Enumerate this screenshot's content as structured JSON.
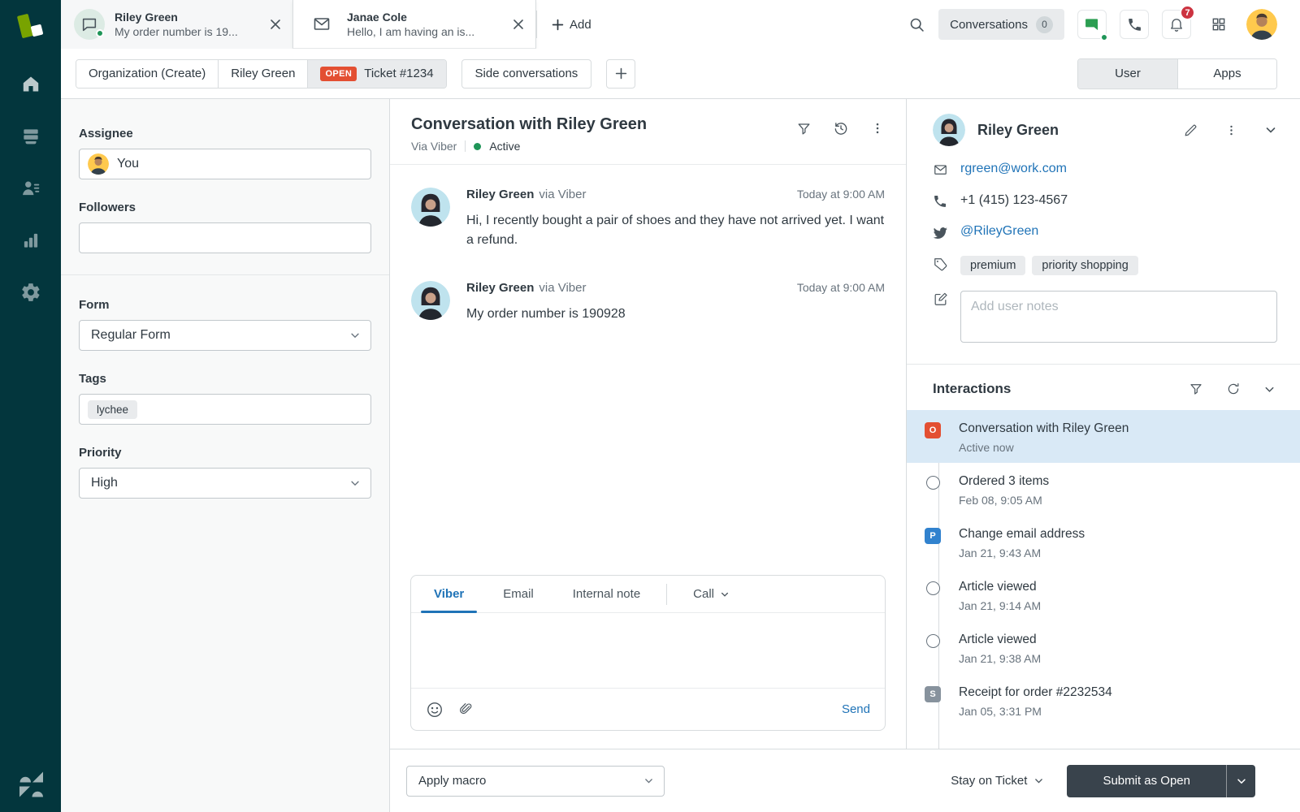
{
  "colors": {
    "kale": "#03363d",
    "accent_blue": "#1f73b7",
    "open_red": "#e34f32",
    "logo_green": "#78a300",
    "messaging_green": "#2b9e51",
    "selected_row_blue": "#d9e9f6"
  },
  "sidebar": {
    "icons": [
      "home",
      "views",
      "customers",
      "reports",
      "admin",
      "zendesk-logo"
    ]
  },
  "tabs": {
    "items": [
      {
        "title": "Riley Green",
        "subtitle": "My order number is 19...",
        "channel": "chat"
      },
      {
        "title": "Janae Cole",
        "subtitle": "Hello, I am having an is...",
        "channel": "email"
      }
    ],
    "add_label": "Add"
  },
  "topbar": {
    "conversations_label": "Conversations",
    "conversations_count": "0",
    "notifications_badge": "7"
  },
  "ticket_nav": {
    "segments": [
      {
        "label": "Organization (Create)"
      },
      {
        "label": "Riley Green"
      },
      {
        "label": "Ticket #1234",
        "status_badge": "OPEN"
      }
    ],
    "side_conversations_label": "Side conversations",
    "context_tabs": [
      {
        "label": "User"
      },
      {
        "label": "Apps"
      }
    ]
  },
  "ticket_fields": {
    "assignee_label": "Assignee",
    "assignee_value": "You",
    "followers_label": "Followers",
    "form_label": "Form",
    "form_value": "Regular Form",
    "tags_label": "Tags",
    "tags": [
      "lychee"
    ],
    "priority_label": "Priority",
    "priority_value": "High"
  },
  "conversation": {
    "title": "Conversation with Riley Green",
    "via": "Via Viber",
    "status": "Active",
    "messages": [
      {
        "author": "Riley Green",
        "via": "via Viber",
        "time": "Today at 9:00 AM",
        "text": "Hi, I recently bought a pair of shoes and they have not arrived yet. I want a refund."
      },
      {
        "author": "Riley Green",
        "via": "via Viber",
        "time": "Today at 9:00 AM",
        "text": "My order number is 190928"
      }
    ],
    "composer": {
      "tabs": [
        "Viber",
        "Email",
        "Internal note"
      ],
      "call_label": "Call",
      "send_label": "Send"
    }
  },
  "customer": {
    "name": "Riley Green",
    "email": "rgreen@work.com",
    "phone": "+1 (415) 123-4567",
    "twitter": "@RileyGreen",
    "tags": [
      "premium",
      "priority shopping"
    ],
    "notes_placeholder": "Add user notes"
  },
  "interactions": {
    "title": "Interactions",
    "items": [
      {
        "badge": "O",
        "title": "Conversation with Riley Green",
        "time": "Active now"
      },
      {
        "badge": "",
        "title": "Ordered 3 items",
        "time": "Feb 08, 9:05 AM"
      },
      {
        "badge": "P",
        "title": "Change email address",
        "time": "Jan 21, 9:43 AM"
      },
      {
        "badge": "",
        "title": "Article viewed",
        "time": "Jan 21, 9:14 AM"
      },
      {
        "badge": "",
        "title": "Article viewed",
        "time": "Jan 21, 9:38 AM"
      },
      {
        "badge": "S",
        "title": "Receipt for order #2232534",
        "time": "Jan 05, 3:31 PM"
      }
    ]
  },
  "footer": {
    "apply_macro_label": "Apply macro",
    "stay_label": "Stay on Ticket",
    "submit_label": "Submit as Open"
  }
}
